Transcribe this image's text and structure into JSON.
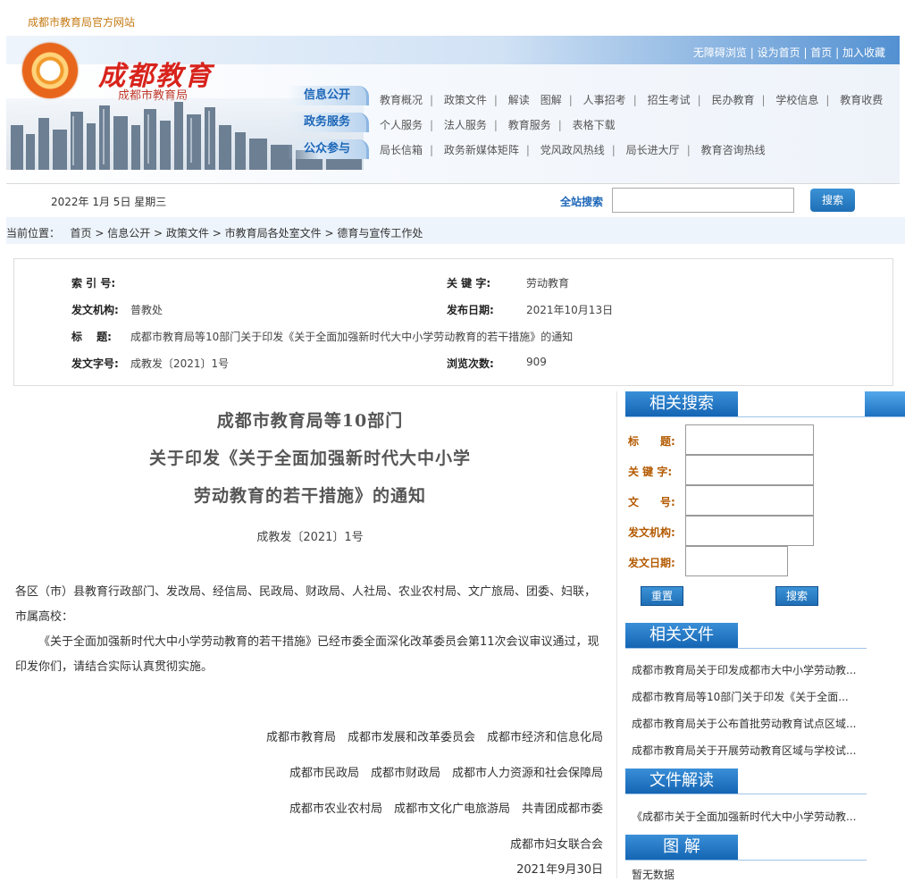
{
  "site": {
    "top_title": "成都市教育局官方网站",
    "logo_title": "成都教育",
    "logo_sub": "成都市教育局"
  },
  "top_links": [
    "无障碍浏览",
    "设为首页",
    "首页",
    "加入收藏"
  ],
  "nav": {
    "rows": [
      {
        "tag": "信息公开",
        "items": [
          "教育概况",
          "政策文件",
          "解读　图解",
          "人事招考",
          "招生考试",
          "民办教育",
          "学校信息",
          "教育收费"
        ]
      },
      {
        "tag": "政务服务",
        "items": [
          "个人服务",
          "法人服务",
          "教育服务",
          "表格下载"
        ]
      },
      {
        "tag": "公众参与",
        "items": [
          "局长信箱",
          "政务新媒体矩阵",
          "党风政风热线",
          "局长进大厅",
          "教育咨询热线"
        ]
      }
    ]
  },
  "date_text": "2022年  1月  5日  星期三",
  "search": {
    "label": "全站搜索",
    "button": "搜索",
    "value": ""
  },
  "breadcrumb": {
    "prefix": "当前位置：",
    "items": [
      "首页",
      "信息公开",
      "政策文件",
      "市教育局各处室文件",
      "德育与宣传工作处"
    ],
    "sep": ">"
  },
  "info": {
    "index_label": "索 引 号:",
    "index_value": "",
    "keyword_label": "关 键 字:",
    "keyword_value": "劳动教育",
    "org_label": "发文机构:",
    "org_value": "普教处",
    "date_label": "发布日期:",
    "date_value": "2021年10月13日",
    "title_label": "标　 题:",
    "title_value": "成都市教育局等10部门关于印发《关于全面加强新时代大中小学劳动教育的若干措施》的通知",
    "docno_label": "发文字号:",
    "docno_value": "成教发〔2021〕1号",
    "views_label": "浏览次数:",
    "views_value": "909"
  },
  "article": {
    "title_lines": [
      "成都市教育局等10部门",
      "关于印发《关于全面加强新时代大中小学",
      "劳动教育的若干措施》的通知"
    ],
    "doc_no": "成教发〔2021〕1号",
    "para1": "各区（市）县教育行政部门、发改局、经信局、民政局、财政局、人社局、农业农村局、文广旅局、团委、妇联，市属高校：",
    "para2": "《关于全面加强新时代大中小学劳动教育的若干措施》已经市委全面深化改革委员会第11次会议审议通过，现印发你们，请结合实际认真贯彻实施。",
    "signers": [
      "成都市教育局　成都市发展和改革委员会　成都市经济和信息化局",
      "成都市民政局　成都市财政局　成都市人力资源和社会保障局",
      "成都市农业农村局　成都市文化广电旅游局　共青团成都市委",
      "成都市妇女联合会"
    ],
    "sign_date": "2021年9月30日"
  },
  "sidebar": {
    "search_head": "相关搜索",
    "fields": [
      "标　　题:",
      "关 键 字:",
      "文　　号:",
      "发文机构:",
      "发文日期:"
    ],
    "reset_btn": "重置",
    "search_btn": "搜索",
    "files_head": "相关文件",
    "files": [
      "成都市教育局关于印发成都市大中小学劳动教...",
      "成都市教育局等10部门关于印发《关于全面...",
      "成都市教育局关于公布首批劳动教育试点区域...",
      "成都市教育局关于开展劳动教育区域与学校试..."
    ],
    "interp_head": "文件解读",
    "interps": [
      "《成都市关于全面加强新时代大中小学劳动教..."
    ],
    "graph_head": "图 解",
    "graphs": [
      "暂无数据"
    ]
  },
  "colors": {
    "accent": "#1c66b8",
    "logo_red": "#d8231c",
    "label_orange": "#b35a00"
  }
}
